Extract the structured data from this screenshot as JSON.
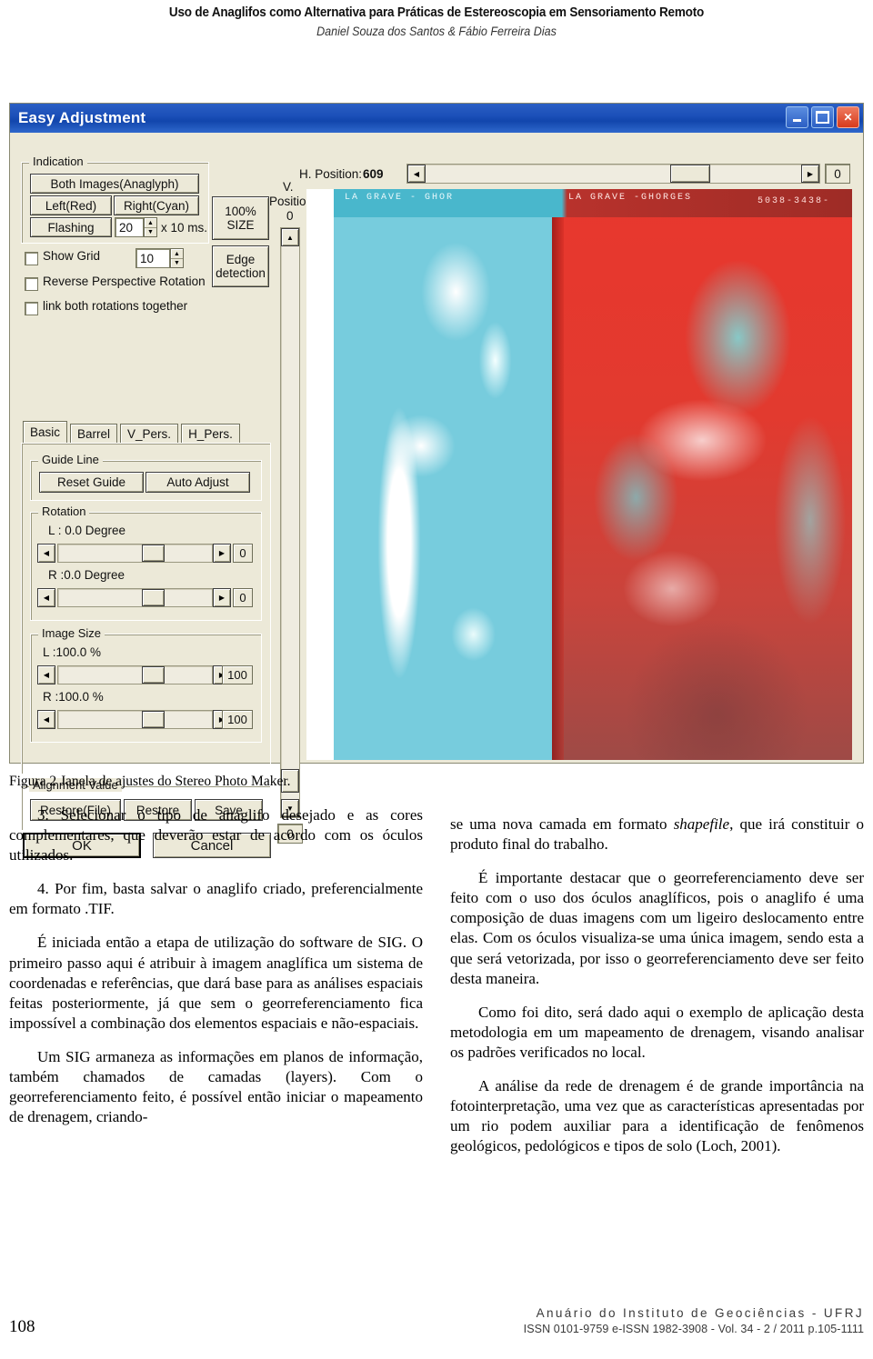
{
  "running_head": {
    "title": "Uso de Anaglifos como Alternativa para Práticas de  Estereoscopia em Sensoriamento Remoto",
    "authors": "Daniel Souza dos Santos & Fábio Ferreira Dias"
  },
  "figure": {
    "caption": "Figura 2  Janela de ajustes do Stereo Photo Maker.",
    "window": {
      "title": "Easy Adjustment",
      "minimize_label": "Minimize",
      "maximize_label": "Maximize",
      "close_label": "Close",
      "indication": {
        "legend": "Indication",
        "both_images": "Both Images(Anaglyph)",
        "left_red": "Left(Red)",
        "right_cyan": "Right(Cyan)",
        "flashing": "Flashing",
        "flashing_value": "20",
        "flashing_unit": "x 10 ms."
      },
      "checkboxes": [
        {
          "label": "Show Grid",
          "checked": false,
          "value": "10"
        },
        {
          "label": "Reverse Perspective Rotation",
          "checked": false
        },
        {
          "label": "link both rotations together",
          "checked": false
        }
      ],
      "size_button": "100%\nSIZE",
      "size_button_l1": "100%",
      "size_button_l2": "SIZE",
      "edge_button_l1": "Edge",
      "edge_button_l2": "detection",
      "tabs": [
        {
          "label": "Basic",
          "selected": true
        },
        {
          "label": "Barrel",
          "selected": false
        },
        {
          "label": "V_Pers.",
          "selected": false
        },
        {
          "label": "H_Pers.",
          "selected": false
        }
      ],
      "guide_line": {
        "legend": "Guide Line",
        "reset_guide": "Reset Guide",
        "auto_adjust": "Auto Adjust"
      },
      "rotation": {
        "legend": "Rotation",
        "left_label": "L : 0.0 Degree",
        "left_value": "0",
        "right_label": "R :0.0 Degree",
        "right_value": "0"
      },
      "image_size": {
        "legend": "Image Size",
        "left_label": "L :100.0 %",
        "left_value": "100",
        "right_label": "R :100.0 %",
        "right_value": "100"
      },
      "alignment_value": {
        "legend": "Alignment Value",
        "restore_file": "Restore(File)",
        "restore": "Restore",
        "save": "Save"
      },
      "ok": "OK",
      "cancel": "Cancel",
      "h_position_label": "H. Position:",
      "h_position_value": "609",
      "h_position_right_value": "0",
      "v_position_label_l1": "V.",
      "v_position_label_l2": "Position",
      "v_position_value": "0",
      "v_scroll_bottom_value": "0",
      "preview": {
        "overlay_left": "LA GRAVE - GHOR",
        "overlay_right": "LA GRAVE -GHORGES",
        "overlay_code": "5038-3438-",
        "color_left": "#77ccdd",
        "color_right": "#e8372e"
      }
    }
  },
  "body": {
    "left_column": [
      "3. Selecionar o tipo de anaglifo desejado e as cores complementares, que deverão estar de acordo com os óculos utilizados.",
      "4. Por fim, basta salvar o anaglifo criado, preferencialmente em formato .TIF.",
      "É iniciada então a etapa de utilização do software de SIG. O primeiro passo aqui é atribuir à imagem anaglífica um sistema de coordenadas e referências, que dará base para as análises espaciais feitas posteriormente, já que sem o georreferenciamento fica impossível a combinação dos elementos espaciais e não-espaciais.",
      "Um SIG armaneza as informações em planos de informação, também chamados de camadas (layers). Com o georreferenciamento feito, é possível então iniciar o mapeamento de drenagem, criando-"
    ],
    "right_column_first_pre": "se uma nova camada em formato ",
    "right_column_first_italic": "shapefile",
    "right_column_first_post": ", que irá constituir o produto final do trabalho.",
    "right_column_rest": [
      "É importante destacar que o georreferenciamento deve ser feito com o uso dos óculos anaglíficos, pois o anaglifo é uma composição de duas imagens com um ligeiro deslocamento entre elas. Com os óculos visualiza-se uma única imagem, sendo esta a que será vetorizada, por isso o georreferenciamento deve ser feito desta maneira.",
      "Como foi dito, será dado aqui o exemplo de aplicação desta metodologia em um mapeamento de drenagem, visando analisar os padrões verificados no local.",
      "A análise da rede de drenagem é de grande importância na fotointerpretação, uma vez que as características apresentadas por um rio podem auxiliar para a identificação de fenômenos geológicos, pedológicos e tipos de solo (Loch, 2001)."
    ]
  },
  "footer": {
    "page_number": "108",
    "journal": "Anuário do Instituto de Geociências - UFRJ",
    "issn_line": "ISSN 0101-9759 e-ISSN 1982-3908 - Vol. 34 - 2 / 2011   p.105-1111"
  }
}
